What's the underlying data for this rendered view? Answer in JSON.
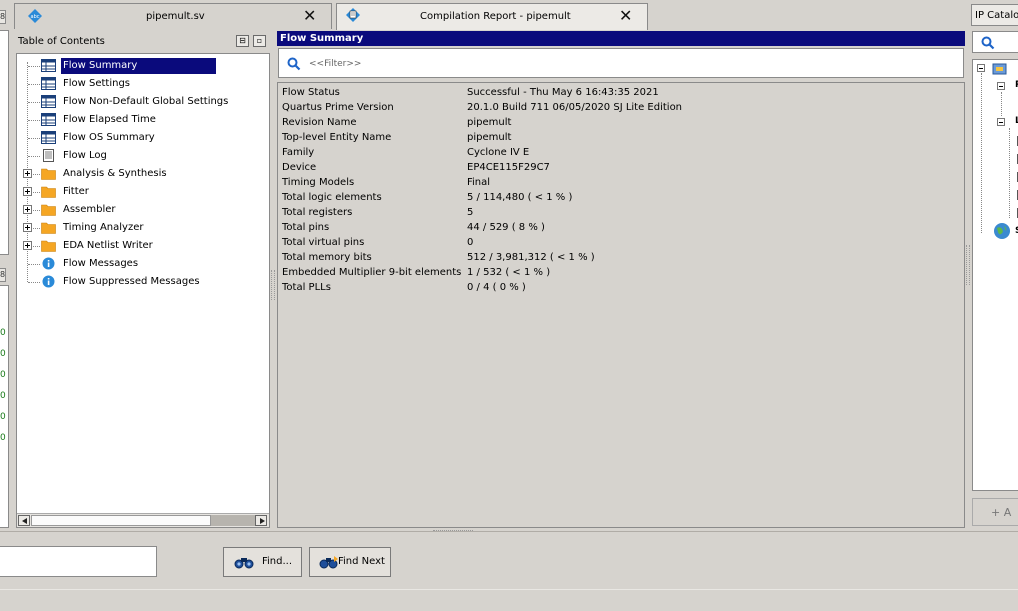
{
  "tabs": [
    {
      "label": "pipemult.sv",
      "icon": "verilog-file-icon"
    },
    {
      "label": "Compilation Report - pipemult",
      "icon": "compilation-report-icon"
    }
  ],
  "toc": {
    "title": "Table of Contents",
    "items": [
      {
        "label": "Flow Summary",
        "icon": "table-icon",
        "selected": true
      },
      {
        "label": "Flow Settings",
        "icon": "table-icon"
      },
      {
        "label": "Flow Non-Default Global Settings",
        "icon": "table-icon"
      },
      {
        "label": "Flow Elapsed Time",
        "icon": "table-icon"
      },
      {
        "label": "Flow OS Summary",
        "icon": "table-icon"
      },
      {
        "label": "Flow Log",
        "icon": "text-file-icon"
      },
      {
        "label": "Analysis & Synthesis",
        "icon": "folder-icon",
        "expandable": true
      },
      {
        "label": "Fitter",
        "icon": "folder-icon",
        "expandable": true
      },
      {
        "label": "Assembler",
        "icon": "folder-icon",
        "expandable": true
      },
      {
        "label": "Timing Analyzer",
        "icon": "folder-icon",
        "expandable": true
      },
      {
        "label": "EDA Netlist Writer",
        "icon": "folder-icon",
        "expandable": true
      },
      {
        "label": "Flow Messages",
        "icon": "info-icon"
      },
      {
        "label": "Flow Suppressed Messages",
        "icon": "info-icon"
      }
    ]
  },
  "summary": {
    "header": "Flow Summary",
    "filter_placeholder": "<<Filter>>",
    "rows": [
      {
        "key": "Flow Status",
        "value": "Successful - Thu May  6 16:43:35 2021"
      },
      {
        "key": "Quartus Prime Version",
        "value": "20.1.0 Build 711 06/05/2020 SJ Lite Edition"
      },
      {
        "key": "Revision Name",
        "value": "pipemult"
      },
      {
        "key": "Top-level Entity Name",
        "value": "pipemult"
      },
      {
        "key": "Family",
        "value": "Cyclone IV E"
      },
      {
        "key": "Device",
        "value": "EP4CE115F29C7"
      },
      {
        "key": "Timing Models",
        "value": "Final"
      },
      {
        "key": "Total logic elements",
        "value": "5 / 114,480 ( < 1 % )"
      },
      {
        "key": "Total registers",
        "value": "5"
      },
      {
        "key": "Total pins",
        "value": "44 / 529 ( 8 % )"
      },
      {
        "key": "Total virtual pins",
        "value": "0"
      },
      {
        "key": "Total memory bits",
        "value": "512 / 3,981,312 ( < 1 % )"
      },
      {
        "key": "Embedded Multiplier 9-bit elements",
        "value": "1 / 532 ( < 1 % )"
      },
      {
        "key": "Total PLLs",
        "value": "0 / 4 ( 0 % )"
      }
    ]
  },
  "ip_catalog": {
    "title": "IP Catalog",
    "tree_letters": [
      "P",
      "L",
      "S"
    ],
    "add_label": "+ A"
  },
  "find_bar": {
    "input_value": "",
    "find_label": "Find...",
    "find_next_label": "Find Next"
  },
  "left_clip": {
    "digits": [
      "0",
      "0",
      "0",
      "0",
      "0",
      "0",
      "0"
    ]
  },
  "colors": {
    "selection": "#0a0a7c",
    "panel_bg": "#d6d3ce",
    "folder": "#f5a623",
    "info": "#2a8ad8"
  }
}
